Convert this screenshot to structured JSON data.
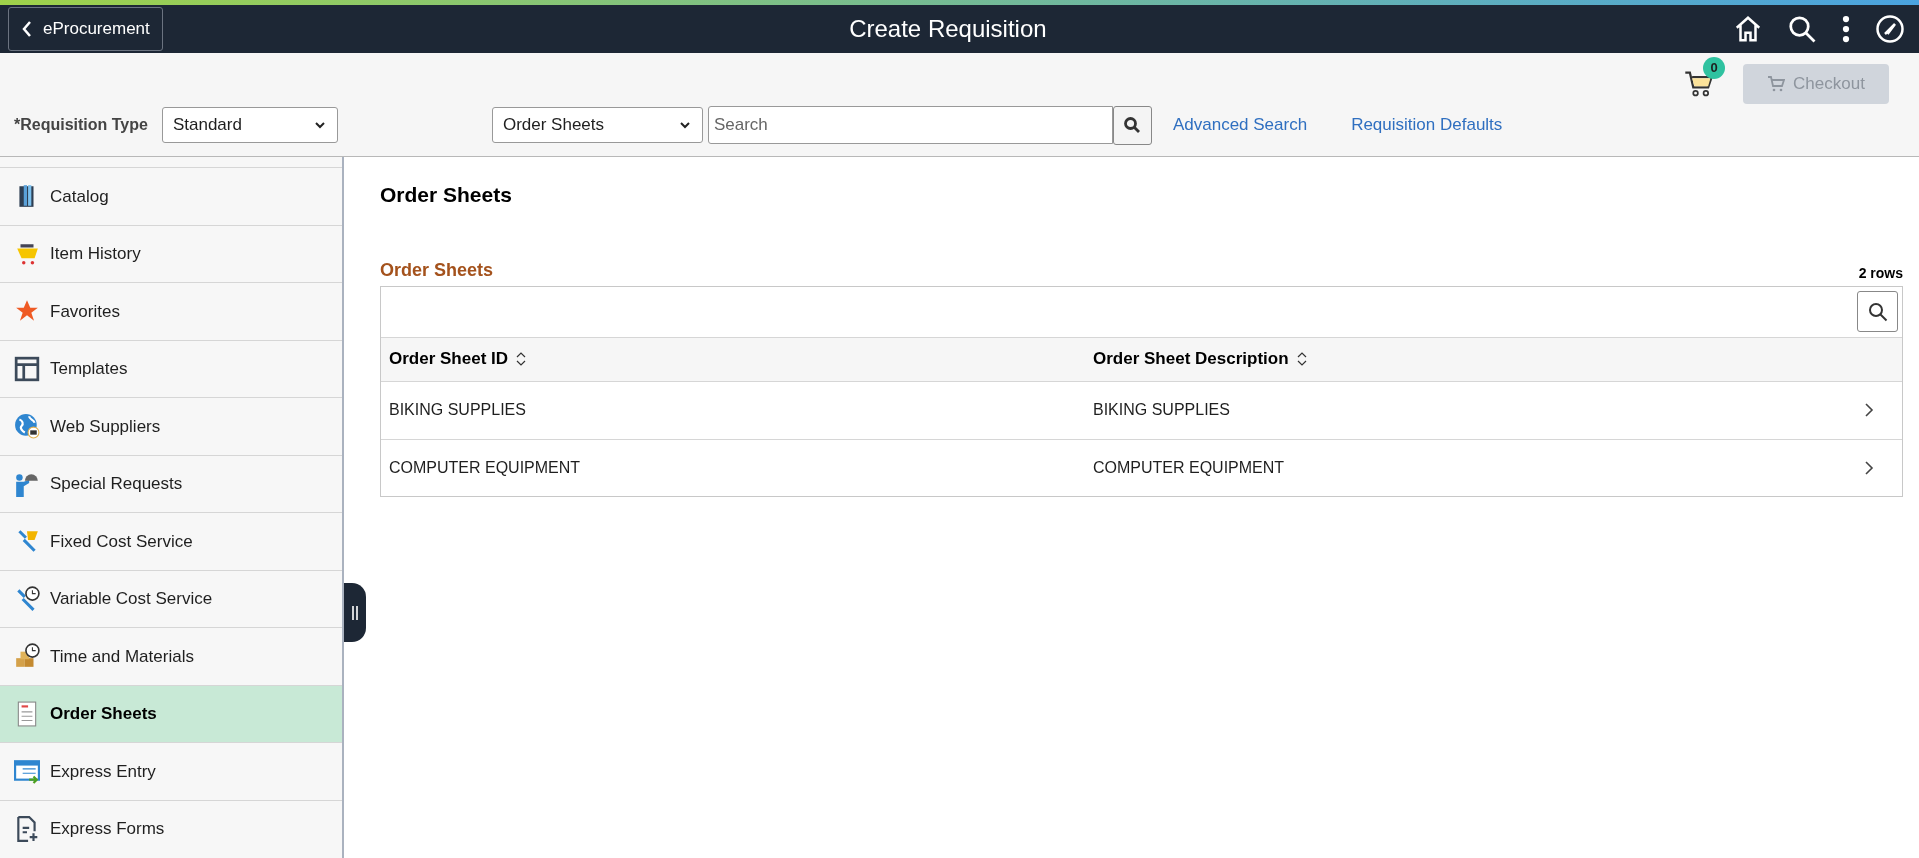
{
  "header": {
    "back_button": "eProcurement",
    "title": "Create Requisition"
  },
  "toolbar": {
    "requisition_type_label": "*Requisition Type",
    "requisition_type": "Standard",
    "search_scope": "Order Sheets",
    "search_placeholder": "Search",
    "links": [
      "Advanced Search",
      "Requisition Defaults"
    ],
    "cart_count": "0",
    "checkout": {
      "label": "Checkout",
      "disabled": true
    }
  },
  "sidebar": {
    "items": [
      {
        "label": "Catalog",
        "selected": false
      },
      {
        "label": "Item History",
        "selected": false
      },
      {
        "label": "Favorites",
        "selected": false
      },
      {
        "label": "Templates",
        "selected": false
      },
      {
        "label": "Web Suppliers",
        "selected": false
      },
      {
        "label": "Special Requests",
        "selected": false
      },
      {
        "label": "Fixed Cost Service",
        "selected": false
      },
      {
        "label": "Variable Cost Service",
        "selected": false
      },
      {
        "label": "Time and Materials",
        "selected": false
      },
      {
        "label": "Order Sheets",
        "selected": true
      },
      {
        "label": "Express Entry",
        "selected": false
      },
      {
        "label": "Express Forms",
        "selected": false
      }
    ]
  },
  "page_title": "Order Sheets",
  "grid": {
    "title": "Order Sheets",
    "row_count": "2 rows",
    "columns": [
      "Order Sheet ID",
      "Order Sheet Description"
    ],
    "rows": [
      [
        "BIKING SUPPLIES",
        "BIKING SUPPLIES"
      ],
      [
        "COMPUTER EQUIPMENT",
        "COMPUTER EQUIPMENT"
      ]
    ]
  }
}
